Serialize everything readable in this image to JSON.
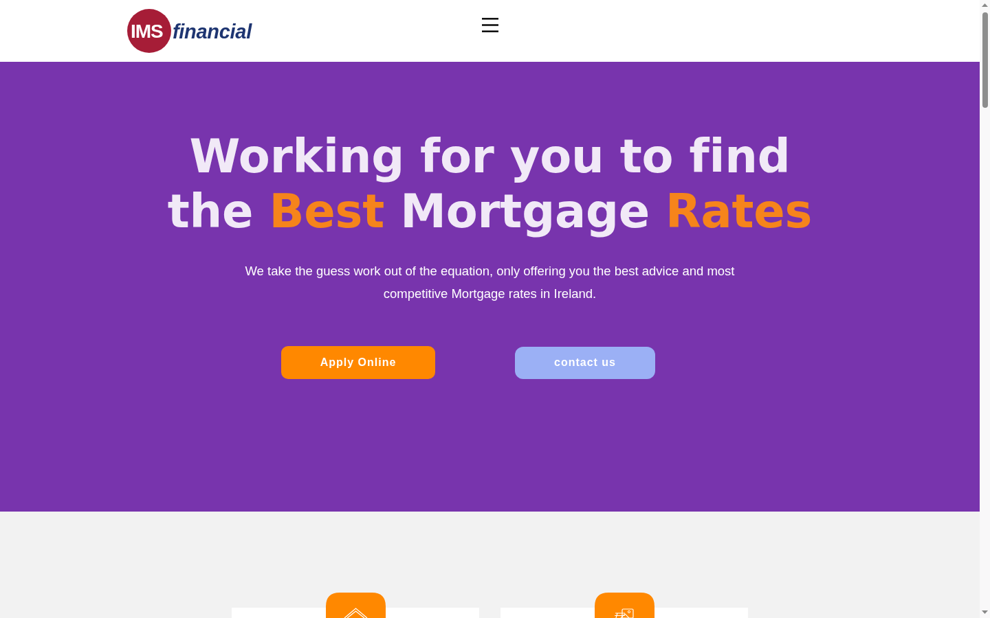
{
  "header": {
    "logo": {
      "mark": "IMS",
      "wordmark": "financial"
    }
  },
  "hero": {
    "heading": [
      {
        "text": "Working for you to find the ",
        "highlight": false
      },
      {
        "text": "Best",
        "highlight": true
      },
      {
        "text": " Mortgage ",
        "highlight": false
      },
      {
        "text": "Rates",
        "highlight": true
      }
    ],
    "subtitle": "We take the guess work out of the equation, only offering you the best advice and most competitive Mortgage rates in Ireland.",
    "buttons": [
      {
        "label": "Apply Online",
        "kind": "primary"
      },
      {
        "label": "contact us",
        "kind": "secondary"
      }
    ]
  },
  "features": [
    {
      "kind": "house"
    },
    {
      "kind": "documents"
    }
  ]
}
